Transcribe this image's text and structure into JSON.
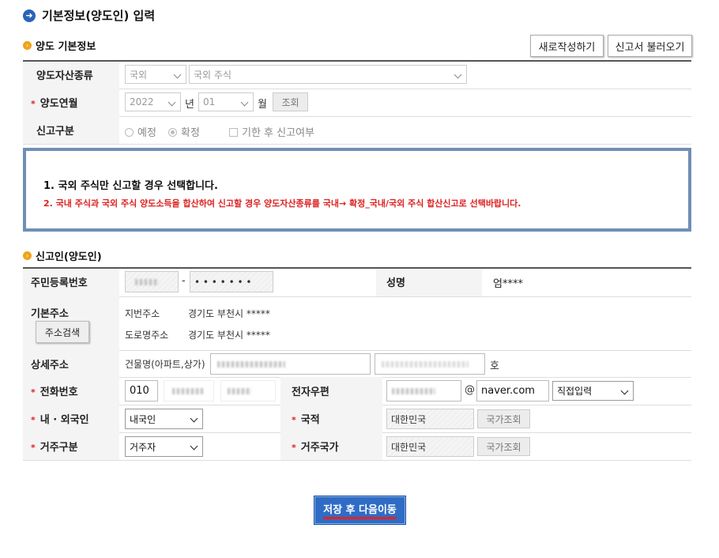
{
  "page": {
    "title": "기본정보(양도인) 입력"
  },
  "section_basic": {
    "title": "양도 기본정보",
    "btn_new": "새로작성하기",
    "btn_load": "신고서 불러오기",
    "asset_type_label": "양도자산종류",
    "asset_type_1": "국외",
    "asset_type_2": "국외 주식",
    "transfer_ym_label": "양도연월",
    "year": "2022",
    "year_unit": "년",
    "month": "01",
    "month_unit": "월",
    "query_btn": "조회",
    "report_type_label": "신고구분",
    "radio_planned": "예정",
    "radio_confirmed": "확정",
    "checkbox_overdue": "기한 후 신고여부"
  },
  "notice": {
    "line1": "1. 국외 주식만 신고할 경우 선택합니다.",
    "line2": "2. 국내 주식과 국외 주식 양도소득을 합산하여 신고할 경우 양도자산종류를 국내→ 확정_국내/국외 주식 합산신고로 선택바랍니다."
  },
  "section_reporter": {
    "title": "신고인(양도인)",
    "rrn_label": "주민등록번호",
    "rrn_dash": "-",
    "rrn_back": "• • • • • • •",
    "name_label": "성명",
    "name_value": "엄****",
    "addr_label": "기본주소",
    "addr_search_btn": "주소검색",
    "jibun_label": "지번주소",
    "jibun_value": "경기도 부천시 *****",
    "road_label": "도로명주소",
    "road_value": "경기도 부천시 *****",
    "detail_label": "상세주소",
    "building_label": "건물명(아파트,상가)",
    "ho_label": "호",
    "phone_label": "전화번호",
    "phone_1": "010",
    "email_label": "전자우편",
    "email_at": "@",
    "email_domain": "naver.com",
    "email_select": "직접입력",
    "nationality_type_label": "내 · 외국인",
    "nationality_type_value": "내국인",
    "nationality_label": "국적",
    "nationality_value": "대한민국",
    "country_btn": "국가조회",
    "residence_label": "거주구분",
    "residence_value": "거주자",
    "residence_country_label": "거주국가",
    "residence_country_value": "대한민국",
    "country_btn2": "국가조회"
  },
  "footer": {
    "save_next": "저장 후 다음이동"
  },
  "colors": {
    "accent": "#2b63b8",
    "required": "#d22222",
    "notice_border": "#6f8fb5"
  }
}
